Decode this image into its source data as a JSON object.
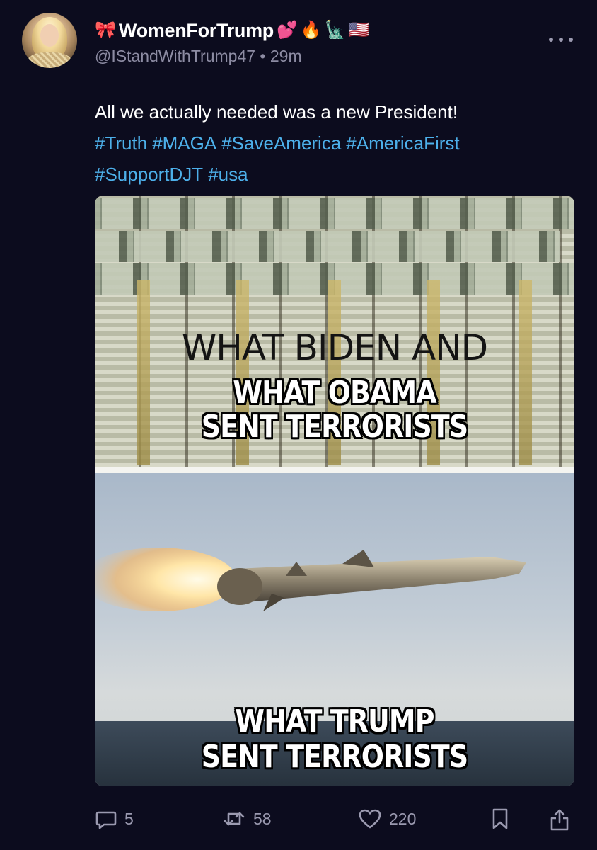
{
  "author": {
    "display_name": "WomenForTrump",
    "name_emojis": [
      "🎀",
      "💕",
      "🔥",
      "🗽",
      "🇺🇸"
    ],
    "handle": "@IStandWithTrump47",
    "separator": "•",
    "time_ago": "29m"
  },
  "post": {
    "text": "All we actually needed was a new President!",
    "hashtags": [
      "#Truth",
      "#MAGA",
      "#SaveAmerica",
      "#AmericaFirst",
      "#SupportDJT",
      "#usa"
    ]
  },
  "meme": {
    "top_caption_line1": "WHAT BIDEN AND",
    "top_caption_line2": "WHAT OBAMA",
    "top_caption_line3": "SENT TERRORISTS",
    "bottom_caption_line1": "WHAT TRUMP",
    "bottom_caption_line2": "SENT TERRORISTS"
  },
  "actions": {
    "replies": "5",
    "reposts": "58",
    "likes": "220"
  },
  "icons": {
    "more": "more-dots-icon",
    "reply": "reply-icon",
    "repost": "repost-icon",
    "like": "heart-icon",
    "bookmark": "bookmark-icon",
    "share": "share-icon"
  },
  "colors": {
    "background": "#0c0c1e",
    "hashtag": "#4db0ea",
    "muted": "#8d8ca3"
  }
}
